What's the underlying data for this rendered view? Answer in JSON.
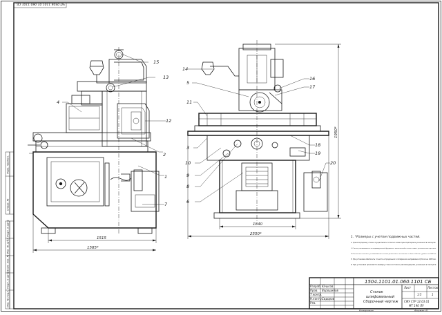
{
  "drawing": {
    "corner_stamp": "ЧП 0504.1101.01.060.1101 СБ",
    "frame_color": "#1a1a1a",
    "background_color": "#ffffff"
  },
  "callouts": [
    "15",
    "13",
    "4",
    "12",
    "2",
    "1",
    "7",
    "14",
    "5",
    "16",
    "17",
    "11",
    "3",
    "10",
    "9",
    "8",
    "6",
    "18",
    "19",
    "20"
  ],
  "dimensions": {
    "left_width_inner": "1515",
    "left_width_total": "1585*",
    "right_width_inner": "1840",
    "right_width_total": "2550*",
    "height_total": "1950*"
  },
  "notes": [
    "1. *Размеры с учетом подвижных частей.",
    "2. Транспортировку станка осуществлять согласно схеме транспортировки указанной в паспорте.",
    "3. Станок устанавливается на индивидуальный фундамент, выполненный в соответствии с установочным чертежом.",
    "4. Отклонение в контакте устанавливаемого станка должно иметь отклонение не более 0,05 мм с уровнем на 1000 мм.",
    "5. При установке обеспечить точность в продольном и поперечном направлении 0,02 мм на 1000 мм.",
    "6. При установке произвести выверку станка согласно рекомендациям указанным в паспорте."
  ],
  "title_block": {
    "designation": "1504.1101.01.060.1101 СБ",
    "title_line1": "Станок",
    "title_line2": "шлифовальный",
    "title_line3": "Сборочный чертеж",
    "sheet_label": "Лист",
    "sheets_label": "Листов",
    "sheets_count": "1",
    "scale": "1:5",
    "org_line1": "СФУ СТР 12.03.01",
    "org_line2": "МТ 190 ЛУ",
    "roles": [
      "Разраб.",
      "Пров.",
      "Т.контр.",
      "Н.контр.",
      "Утв."
    ],
    "names": [
      "Юнусов",
      "Ворошилов",
      "",
      "Сидоров",
      ""
    ],
    "format_left": "Копировал",
    "format_right": "Формат А1"
  },
  "margin_labels": [
    "Перв. примен.",
    "Справ. №",
    "Подп. и дата",
    "Инв. № дубл.",
    "Взам. инв. №",
    "Подп. и дата",
    "Инв. № подл."
  ]
}
